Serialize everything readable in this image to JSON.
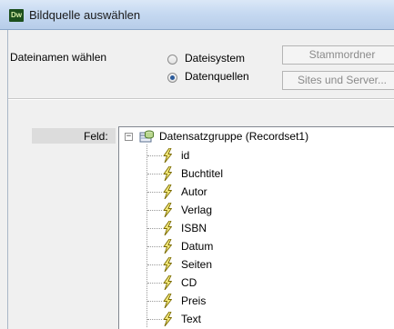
{
  "window": {
    "logo_text": "Dw",
    "title": "Bildquelle auswählen"
  },
  "source": {
    "label": "Dateinamen wählen",
    "options": [
      {
        "label": "Dateisystem",
        "selected": false
      },
      {
        "label": "Datenquellen",
        "selected": true
      }
    ],
    "buttons": {
      "root_folder": "Stammordner",
      "sites_servers": "Sites und Server..."
    }
  },
  "field": {
    "label": "Feld:",
    "tree": {
      "root": "Datensatzgruppe (Recordset1)",
      "expander": "−",
      "items": [
        "id",
        "Buchtitel",
        "Autor",
        "Verlag",
        "ISBN",
        "Datum",
        "Seiten",
        "CD",
        "Preis",
        "Text"
      ]
    }
  },
  "colors": {
    "titlebar": "#c6d9f1",
    "bolt_fill": "#f3e87a",
    "bolt_stroke": "#7a6a00",
    "radio_selected": "#2a5a9a"
  },
  "icons": {
    "app": "dreamweaver-logo-icon",
    "root": "recordset-icon",
    "item": "dynamic-field-bolt-icon"
  }
}
